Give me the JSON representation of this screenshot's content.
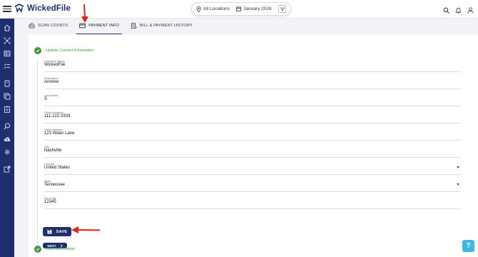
{
  "app": {
    "name": "WickedFile"
  },
  "header": {
    "location": "All Locations",
    "period": "January 2026"
  },
  "tabs": [
    {
      "label": "SCAN COUNTS",
      "icon": "scanner-icon"
    },
    {
      "label": "PAYMENT INFO",
      "icon": "credit-card-icon",
      "active": true
    },
    {
      "label": "BILL & PAYMENT HISTORY",
      "icon": "receipt-icon"
    }
  ],
  "contact_section": {
    "title": "Update Contact Information",
    "fields": [
      {
        "label": "Company Name",
        "value": "WickedFile"
      },
      {
        "label": "First Name",
        "value": "Andrew"
      },
      {
        "label": "Last Name",
        "value": "S"
      },
      {
        "label": "Phone Number",
        "value": "111-222-3333"
      },
      {
        "label": "Street Address",
        "value": "123 Water Lane"
      },
      {
        "label": "City",
        "value": "Nashville"
      },
      {
        "label": "Country",
        "value": "United States",
        "dropdown": true
      },
      {
        "label": "State",
        "value": "Tennessee",
        "dropdown": true
      },
      {
        "label": "Zip Code",
        "value": "12345"
      }
    ],
    "save_label": "SAVE",
    "next_label": "NEXT"
  },
  "card_section": {
    "title": "Card Information"
  },
  "help": {
    "label": "?"
  },
  "colors": {
    "navy": "#1f2f6e",
    "success": "#3b9a42",
    "annotation": "#e0231c",
    "help": "#3fb6e6"
  }
}
